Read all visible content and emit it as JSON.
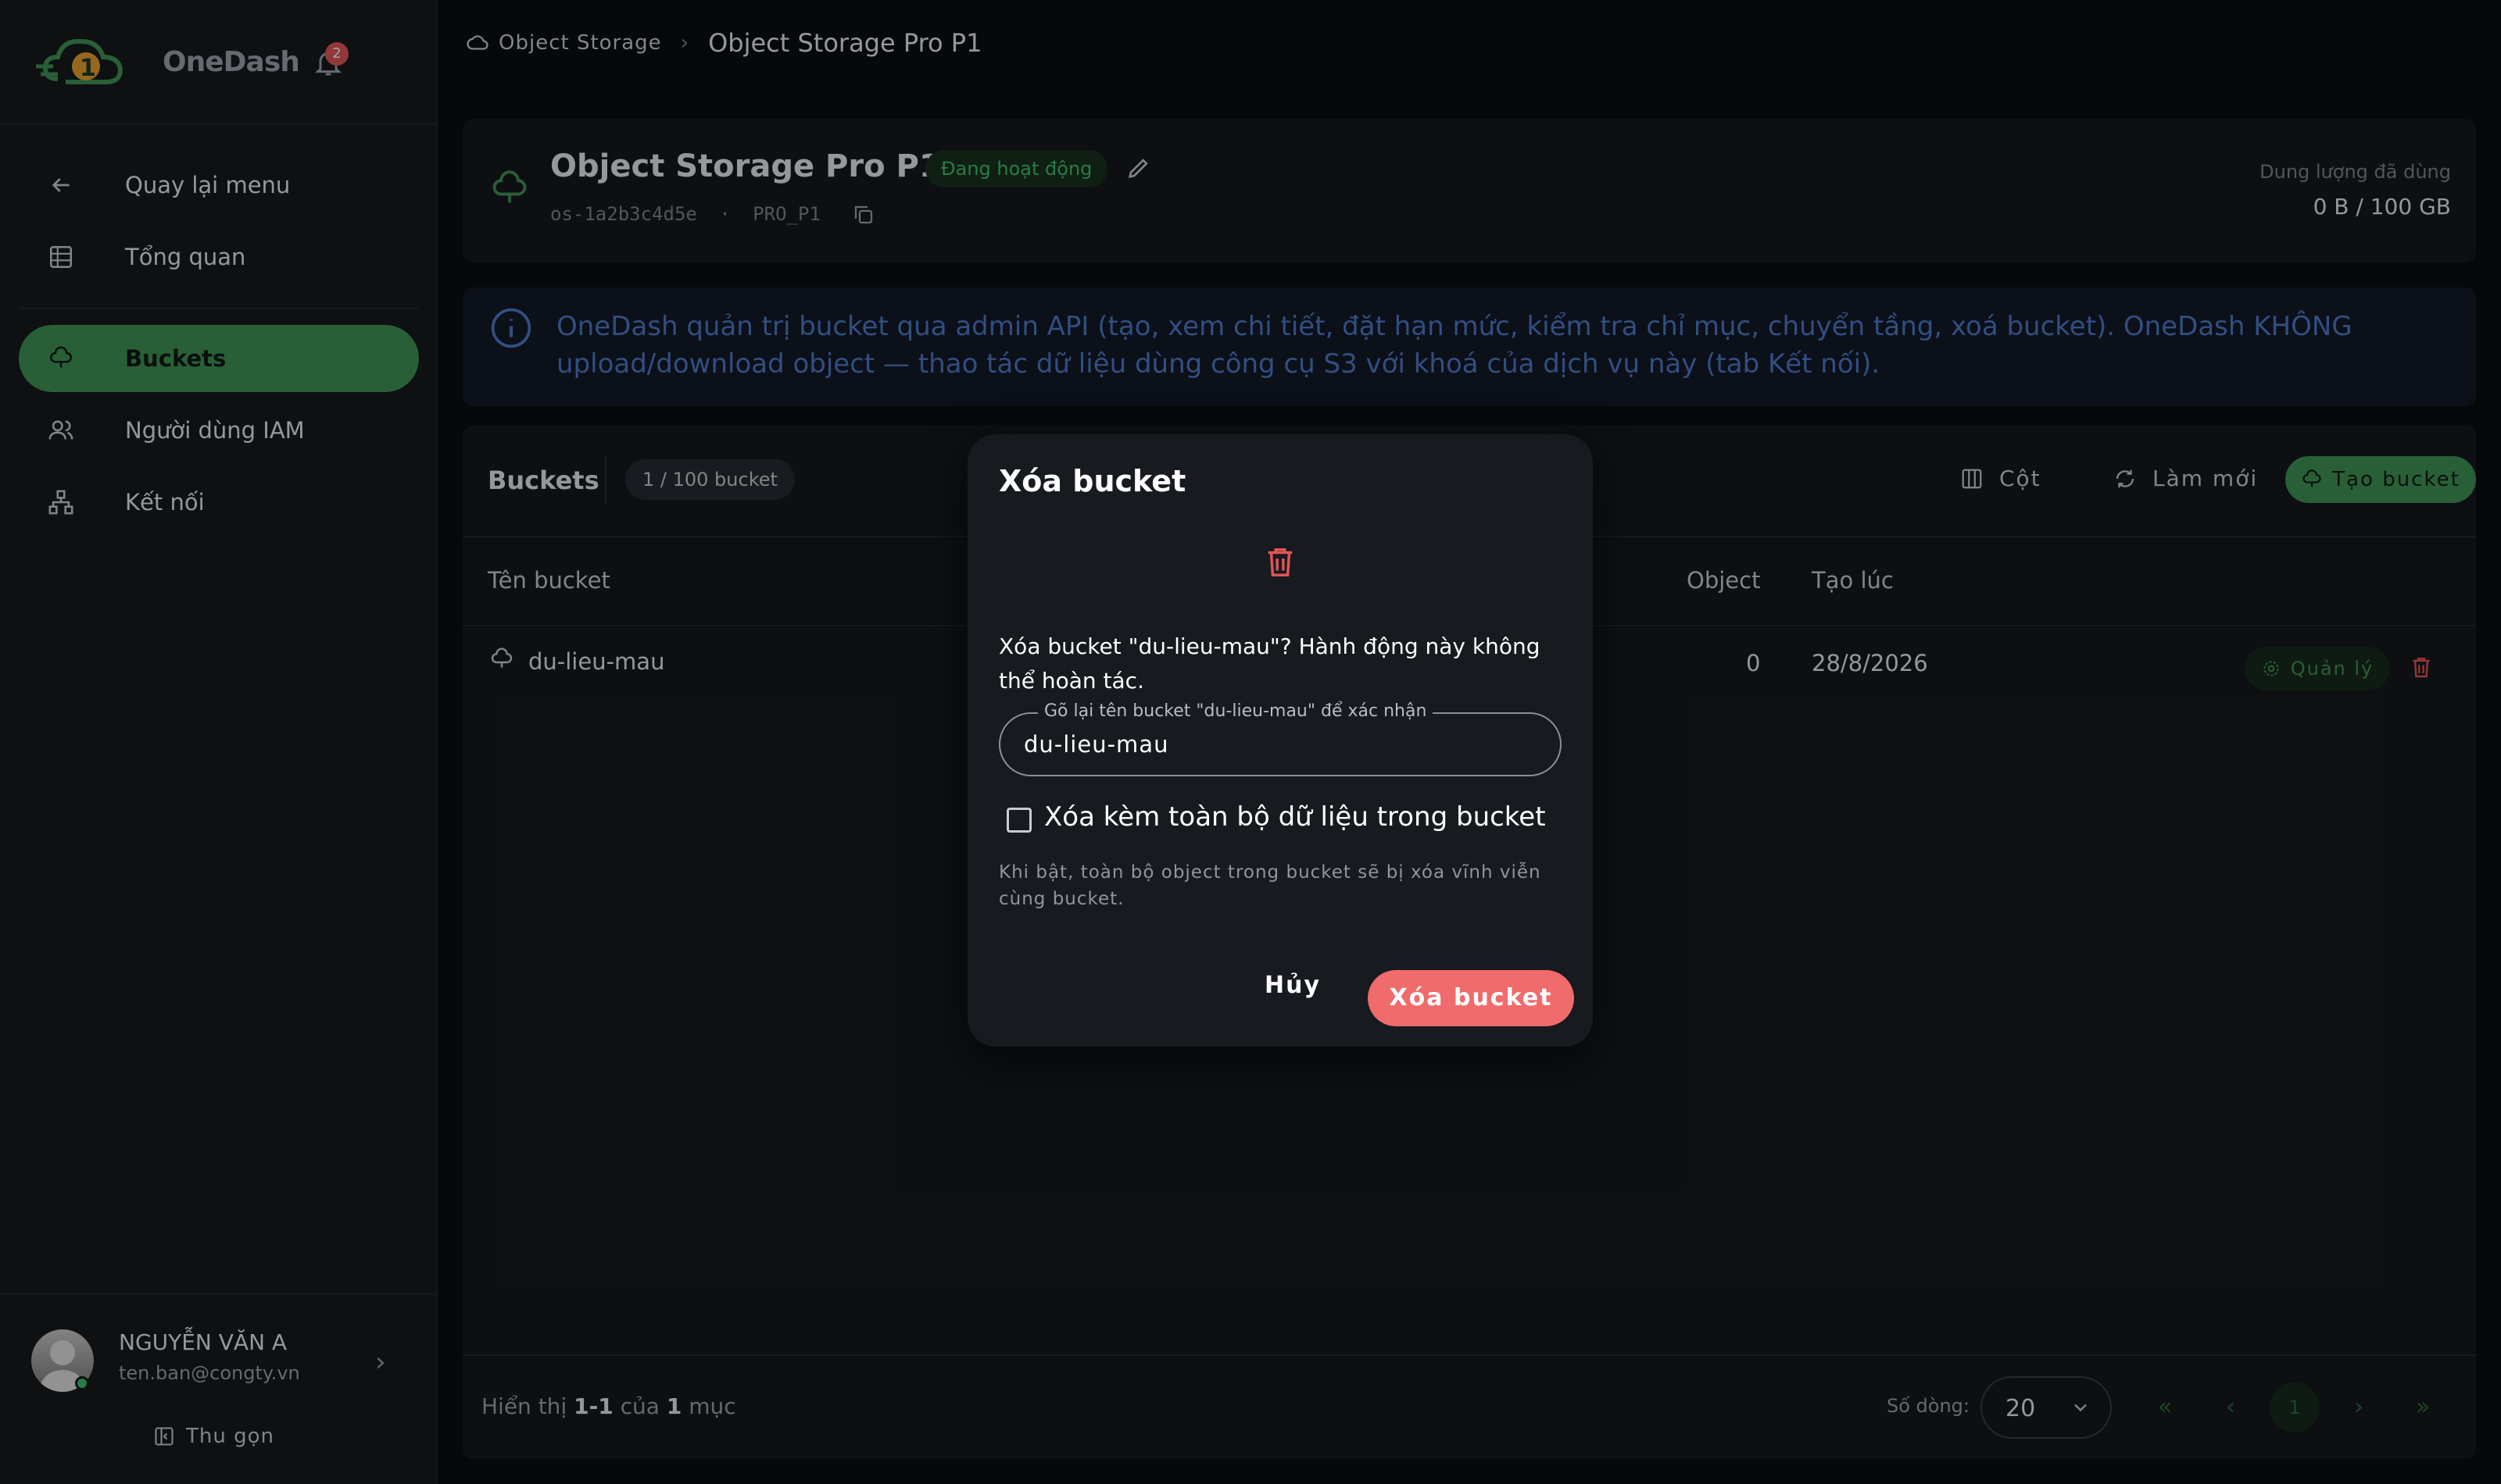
{
  "brand": {
    "name": "OneDash",
    "notifications": "2"
  },
  "sidebar": {
    "items": [
      {
        "label": "Quay lại menu",
        "icon": "arrow-left-icon"
      },
      {
        "label": "Tổng quan",
        "icon": "dashboard-icon"
      },
      {
        "label": "Buckets",
        "icon": "bucket-icon",
        "active": true
      },
      {
        "label": "Người dùng IAM",
        "icon": "users-icon"
      },
      {
        "label": "Kết nối",
        "icon": "network-icon"
      }
    ]
  },
  "user": {
    "name": "NGUYỄN VĂN A",
    "email": "ten.ban@congty.vn",
    "collapse": "Thu gọn"
  },
  "breadcrumb": {
    "root": "Object Storage",
    "current": "Object Storage Pro P1"
  },
  "service": {
    "name": "Object Storage Pro P1",
    "status": "Đang hoạt động",
    "id": "os-1a2b3c4d5e",
    "plan": "PRO_P1",
    "usage_label": "Dung lượng đã dùng",
    "usage_value": "0 B / 100 GB"
  },
  "info": {
    "text": "OneDash quản trị bucket qua admin API (tạo, xem chi tiết, đặt hạn mức, kiểm tra chỉ mục, chuyển tầng, xoá bucket). OneDash KHÔNG upload/download object — thao tác dữ liệu dùng công cụ S3 với khoá của dịch vụ này (tab Kết nối)."
  },
  "buckets": {
    "title": "Buckets",
    "count": "1 / 100 bucket",
    "columns_btn": "Cột",
    "refresh_btn": "Làm mới",
    "create_btn": "Tạo bucket",
    "headers": {
      "name": "Tên bucket",
      "objects": "Object",
      "created": "Tạo lúc"
    },
    "rows": [
      {
        "name": "du-lieu-mau",
        "objects": "0",
        "created": "28/8/2026",
        "manage": "Quản lý"
      }
    ]
  },
  "footer": {
    "showing_prefix": "Hiển thị ",
    "range": "1-1",
    "of": " của ",
    "total": "1",
    "suffix": " mục",
    "rows_label": "Số dòng:",
    "rows_value": "20",
    "page": "1"
  },
  "modal": {
    "title": "Xóa bucket",
    "message": "Xóa bucket \"du-lieu-mau\"? Hành động này không thể hoàn tác.",
    "field_label": "Gõ lại tên bucket \"du-lieu-mau\" để xác nhận",
    "field_value": "du-lieu-mau",
    "checkbox_label": "Xóa kèm toàn bộ dữ liệu trong bucket",
    "hint": "Khi bật, toàn bộ object trong bucket sẽ bị xóa vĩnh viễn cùng bucket.",
    "cancel": "Hủy",
    "confirm": "Xóa bucket"
  },
  "colors": {
    "accent": "#3f9355",
    "danger": "#f06b6b",
    "info": "#4d79c7"
  }
}
